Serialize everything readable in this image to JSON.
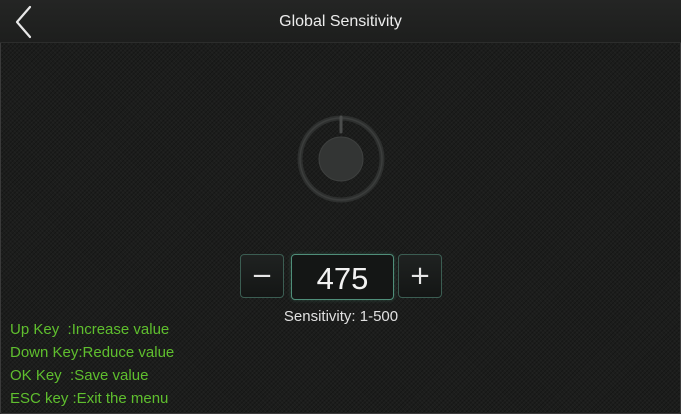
{
  "header": {
    "title": "Global Sensitivity",
    "back_icon": "chevron-left-icon"
  },
  "main": {
    "power_icon": "power-icon",
    "stepper": {
      "minus_label": "−",
      "plus_label": "+",
      "value": "475",
      "range_label": "Sensitivity: 1-500"
    }
  },
  "help": {
    "lines": [
      "Up Key  :Increase value",
      "Down Key:Reduce value",
      "OK Key  :Save value",
      "ESC key :Exit the menu"
    ]
  },
  "colors": {
    "background": "#1c1d1c",
    "help_text": "#5fbf2e",
    "accent_border": "#4f8e79"
  }
}
